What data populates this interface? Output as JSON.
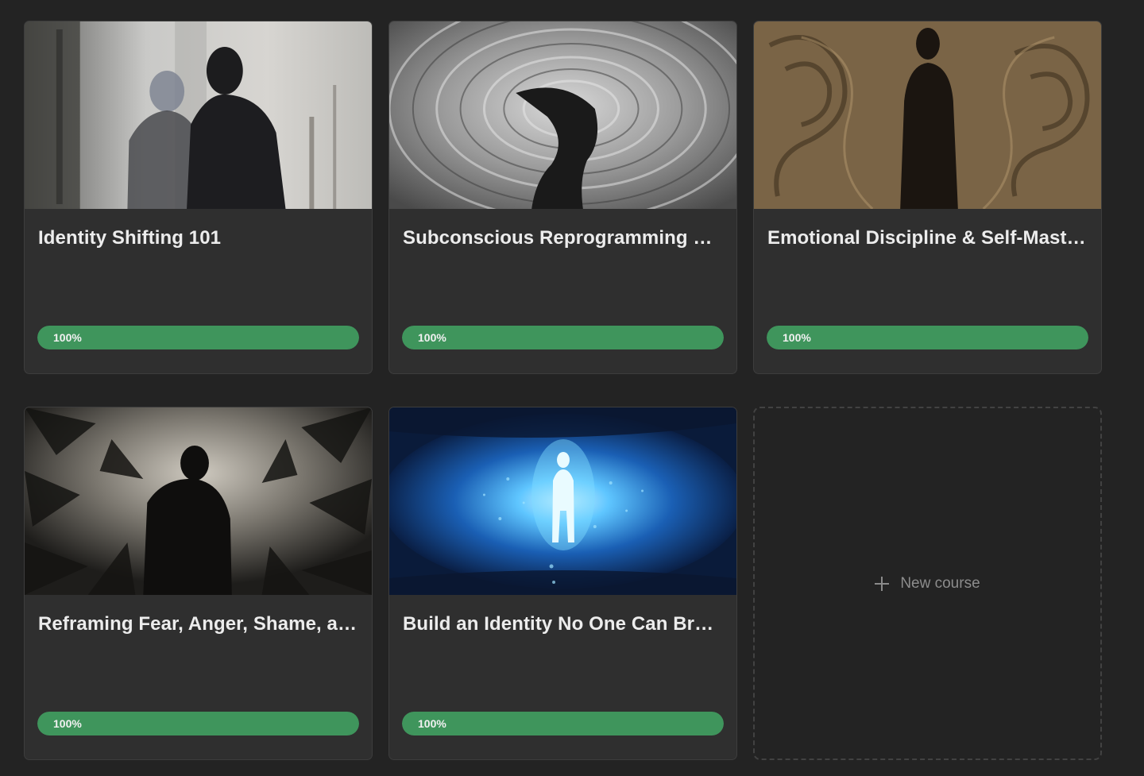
{
  "courses": [
    {
      "title": "Identity Shifting 101",
      "progress_label": "100%",
      "progress": 1.0,
      "image": "two-shadow-figures-painting"
    },
    {
      "title": "Subconscious Reprogramming M...",
      "progress_label": "100%",
      "progress": 1.0,
      "image": "swirling-vortex-figure"
    },
    {
      "title": "Emotional Discipline & Self-Maste...",
      "progress_label": "100%",
      "progress": 1.0,
      "image": "sepia-standing-figure"
    },
    {
      "title": "Reframing Fear, Anger, Shame, an...",
      "progress_label": "100%",
      "progress": 1.0,
      "image": "charcoal-figure-thorns"
    },
    {
      "title": "Build an Identity No One Can Break",
      "progress_label": "100%",
      "progress": 1.0,
      "image": "glowing-figure-in-eye"
    }
  ],
  "new_course": {
    "label": "New course",
    "icon": "plus-icon"
  },
  "colors": {
    "background": "#232323",
    "card": "#2f2f2f",
    "progress_fill": "#3f955c"
  }
}
